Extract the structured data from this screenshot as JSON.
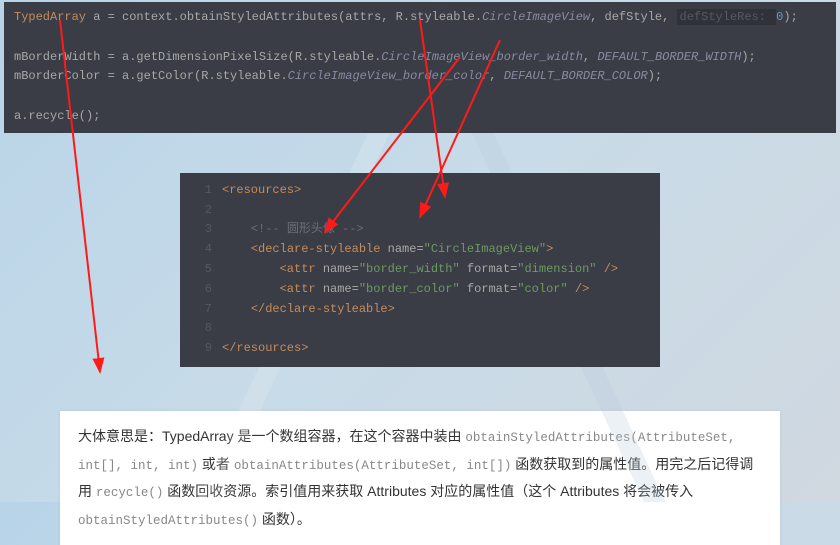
{
  "code_top": {
    "l1_a": "TypedArray",
    "l1_b": " a ",
    "l1_c": "=",
    "l1_d": " context.obtainStyledAttributes(attrs, R.styleable.",
    "l1_e": "CircleImageView",
    "l1_f": ", defStyle, ",
    "l1_hint": "defStyleRes: ",
    "l1_zero": "0",
    "l1_close": ");",
    "l3_a": "mBorderWidth ",
    "l3_b": "= a.getDimensionPixelSize(R.styleable.",
    "l3_c": "CircleImageView_border_width",
    "l3_d": ", ",
    "l3_e": "DEFAULT_BORDER_WIDTH",
    "l3_f": ");",
    "l4_a": "mBorderColor ",
    "l4_b": "= a.getColor(R.styleable.",
    "l4_c": "CircleImageView_border_color",
    "l4_d": ", ",
    "l4_e": "DEFAULT_BORDER_COLOR",
    "l4_f": ");",
    "l6": "a.recycle();"
  },
  "code_xml": {
    "r1_open": "<resources>",
    "r3_cmt": "<!-- 圆形头像 -->",
    "r4_a": "<declare-styleable ",
    "r4_b": "name=",
    "r4_c": "\"CircleImageView\"",
    "r4_d": ">",
    "r5_a": "<attr ",
    "r5_b": "name=",
    "r5_c": "\"border_width\"",
    "r5_d": " format=",
    "r5_e": "\"dimension\"",
    "r5_f": " />",
    "r6_a": "<attr ",
    "r6_b": "name=",
    "r6_c": "\"border_color\"",
    "r6_d": " format=",
    "r6_e": "\"color\"",
    "r6_f": " />",
    "r7": "</declare-styleable>",
    "r9": "</resources>",
    "ln1": "1",
    "ln2": "2",
    "ln3": "3",
    "ln4": "4",
    "ln5": "5",
    "ln6": "6",
    "ln7": "7",
    "ln8": "8",
    "ln9": "9"
  },
  "explain": {
    "p1a": "大体意思是：TypedArray 是一个数组容器，在这个容器中装由 ",
    "p1b": "obtainStyledAttributes(AttributeSet, int[], int, int)",
    "p1c": " 或者 ",
    "p1d": "obtainAttributes(AttributeSet, int[])",
    "p1e": " 函数获取到的属性值。用完之后记得调用 ",
    "p1f": "recycle()",
    "p1g": " 函数回收资源。索引值用来获取 Attributes 对应的属性值（这个 Attributes 将会被传入 ",
    "p1h": "obtainStyledAttributes()",
    "p1i": " 函数）。"
  }
}
